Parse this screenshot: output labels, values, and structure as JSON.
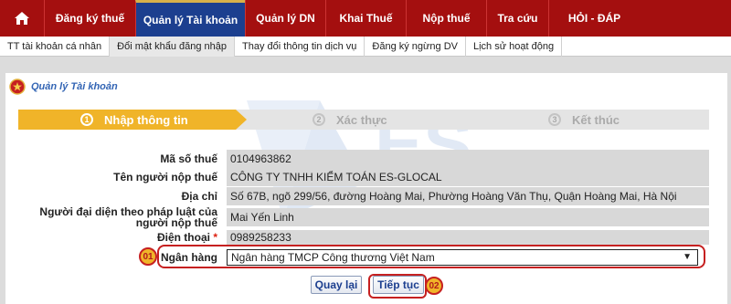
{
  "nav": {
    "items": [
      "Đăng ký thuế",
      "Quản lý Tài khoản",
      "Quản lý DN",
      "Khai Thuế",
      "Nộp thuế",
      "Tra cứu",
      "HỎI - ĐÁP"
    ],
    "active_index": 1
  },
  "subnav": {
    "items": [
      "TT tài khoản cá nhân",
      "Đổi mật khẩu đăng nhập",
      "Thay đổi thông tin dịch vụ",
      "Đăng ký ngừng DV",
      "Lịch sử hoạt động"
    ],
    "active_index": 1
  },
  "page": {
    "title": "Quản lý Tài khoản"
  },
  "steps": [
    {
      "num": "1",
      "label": "Nhập thông tin"
    },
    {
      "num": "2",
      "label": "Xác thực"
    },
    {
      "num": "3",
      "label": "Kết thúc"
    }
  ],
  "form": {
    "mst_label": "Mã số thuế",
    "mst_value": "0104963862",
    "name_label": "Tên người nộp thuế",
    "name_value": "CÔNG TY TNHH KIỂM TOÁN ES-GLOCAL",
    "addr_label": "Địa chỉ",
    "addr_value": "Số 67B, ngõ 299/56, đường Hoàng Mai, Phường Hoàng Văn Thụ, Quận Hoàng Mai, Hà Nội",
    "rep_label": "Người đại diện theo pháp luật của người nộp thuế",
    "rep_value": "Mai Yến Linh",
    "phone_label": "Điện thoại",
    "phone_required": "*",
    "phone_value": "0989258233",
    "bank_label": "Ngân hàng",
    "bank_value": "Ngân hàng TMCP Công thương Việt Nam"
  },
  "annotations": {
    "bank_marker": "01",
    "continue_marker": "02"
  },
  "buttons": {
    "back": "Quay lại",
    "continue": "Tiếp tục"
  },
  "colors": {
    "nav_bg": "#a40f0f",
    "nav_active": "#1c3f8f",
    "step_active": "#f0b429",
    "highlight": "#c62020"
  }
}
